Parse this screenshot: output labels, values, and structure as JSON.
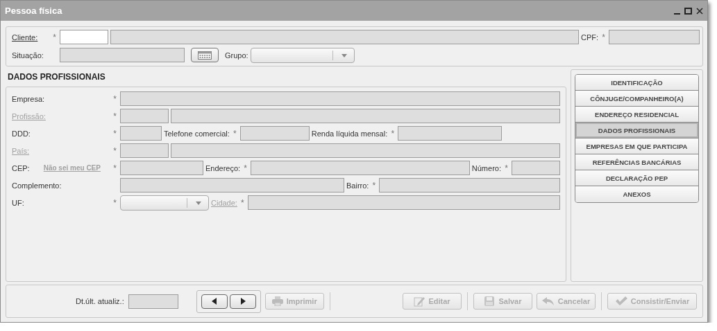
{
  "window": {
    "title": "Pessoa física"
  },
  "header": {
    "lines": [
      {
        "items": [
          {
            "kind": "link",
            "text": "Cliente:",
            "disabled": false
          },
          {
            "kind": "input",
            "mark": "*",
            "editable": true
          },
          {
            "kind": "input",
            "editable": false
          },
          {
            "kind": "label",
            "text": "CPF:"
          },
          {
            "kind": "input",
            "mark": "*",
            "editable": false
          }
        ]
      },
      {
        "items": [
          {
            "kind": "label",
            "text": "Situação:"
          },
          {
            "kind": "input",
            "editable": false
          },
          {
            "kind": "button"
          },
          {
            "kind": "label",
            "text": "Grupo:"
          },
          {
            "kind": "select"
          }
        ]
      }
    ]
  },
  "section": {
    "title": "DADOS PROFISSIONAIS",
    "lines": [
      {
        "items": [
          {
            "kind": "label",
            "text": "Empresa:"
          },
          {
            "kind": "input",
            "mark": "*",
            "editable": false
          }
        ]
      },
      {
        "items": [
          {
            "kind": "link",
            "text": "Profissão:",
            "disabled": true
          },
          {
            "kind": "input",
            "mark": "*",
            "editable": false
          },
          {
            "kind": "input",
            "editable": false
          }
        ]
      },
      {
        "items": [
          {
            "kind": "label",
            "text": "DDD:"
          },
          {
            "kind": "input",
            "mark": "*",
            "editable": false
          },
          {
            "kind": "label",
            "text": "Telefone comercial:"
          },
          {
            "kind": "input",
            "mark": "*",
            "editable": false
          },
          {
            "kind": "label",
            "text": "Renda líquida mensal:"
          },
          {
            "kind": "input",
            "mark": "*",
            "editable": false
          }
        ]
      },
      {
        "items": [
          {
            "kind": "link",
            "text": "País:",
            "disabled": true
          },
          {
            "kind": "input",
            "mark": "*",
            "editable": false
          },
          {
            "kind": "input",
            "editable": false
          }
        ]
      },
      {
        "items": [
          {
            "kind": "label",
            "text": "CEP:"
          },
          {
            "kind": "link",
            "text": "Não sei meu CEP",
            "disabled": true
          },
          {
            "kind": "input",
            "mark": "*",
            "editable": false
          },
          {
            "kind": "label",
            "text": "Endereço:"
          },
          {
            "kind": "input",
            "mark": "*",
            "editable": false
          },
          {
            "kind": "label",
            "text": "Número:"
          },
          {
            "kind": "input",
            "mark": "*",
            "editable": false
          }
        ]
      },
      {
        "items": [
          {
            "kind": "label",
            "text": "Complemento:"
          },
          {
            "kind": "input",
            "editable": false
          },
          {
            "kind": "label",
            "text": "Bairro:"
          },
          {
            "kind": "input",
            "mark": "*",
            "editable": false
          }
        ]
      },
      {
        "items": [
          {
            "kind": "label",
            "text": "UF:"
          },
          {
            "kind": "select",
            "mark": "*"
          },
          {
            "kind": "link",
            "text": "Cidade:",
            "disabled": true
          },
          {
            "kind": "input",
            "mark": "*",
            "editable": false
          }
        ]
      }
    ]
  },
  "nav": [
    {
      "label": "IDENTIFICAÇÃO",
      "selected": false
    },
    {
      "label": "CÔNJUGE/COMPANHEIRO(A)",
      "selected": false
    },
    {
      "label": "ENDEREÇO RESIDENCIAL",
      "selected": false
    },
    {
      "label": "DADOS PROFISSIONAIS",
      "selected": true
    },
    {
      "label": "EMPRESAS EM QUE PARTICIPA",
      "selected": false
    },
    {
      "label": "REFERÊNCIAS BANCÁRIAS",
      "selected": false
    },
    {
      "label": "DECLARAÇÃO PEP",
      "selected": false
    },
    {
      "label": "ANEXOS",
      "selected": false
    }
  ],
  "footer": {
    "updated_label": "Dt.últ. atualiz.:",
    "print_button": {
      "kind": "print",
      "label": "Imprimir",
      "disabled": true
    },
    "action_groups": [
      [
        {
          "kind": "edit",
          "label": "Editar",
          "disabled": true
        }
      ],
      [
        {
          "kind": "save",
          "label": "Salvar",
          "disabled": true
        },
        {
          "kind": "cancel",
          "label": "Cancelar",
          "disabled": true
        }
      ],
      [
        {
          "kind": "send",
          "label": "Consistir/Enviar",
          "disabled": true
        }
      ]
    ]
  }
}
